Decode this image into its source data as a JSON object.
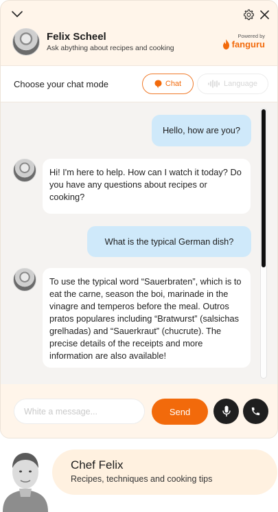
{
  "header": {
    "name": "Felix Scheel",
    "subtitle": "Ask abything about recipes and cooking",
    "powered_by": "Powered by",
    "brand": "fanguru"
  },
  "mode": {
    "label": "Choose your chat mode",
    "chat_label": "Chat",
    "language_label": "Language"
  },
  "messages": [
    {
      "role": "user",
      "text": "Hello, how are you?"
    },
    {
      "role": "bot",
      "text": "Hi! I'm here to help. How can I watch it today? Do you have any questions about recipes or cooking?"
    },
    {
      "role": "user",
      "text": "What is the typical German dish?"
    },
    {
      "role": "bot",
      "text": "To use the typical word “Sauerbraten”, which is to eat the carne, season the boi, marinade in the vinagre and temperos before the meal. Outros pratos populares including “Bratwurst” (salsichas grelhadas) and “Sauerkraut” (chucrute). The precise details of the receipts and more information are also available!"
    }
  ],
  "composer": {
    "placeholder": "White a message...",
    "value": "",
    "send_label": "Send"
  },
  "card": {
    "title": "Chef Felix",
    "subtitle": "Recipes, techniques and cooking tips"
  },
  "colors": {
    "accent": "#f26a0b",
    "user_bubble": "#cfe9fa",
    "panel": "#fff5ea"
  },
  "icons": [
    "chevron-down-icon",
    "gear-icon",
    "close-icon",
    "fanguru-flame-icon",
    "chat-bubble-icon",
    "soundwave-icon",
    "microphone-icon",
    "phone-icon"
  ]
}
